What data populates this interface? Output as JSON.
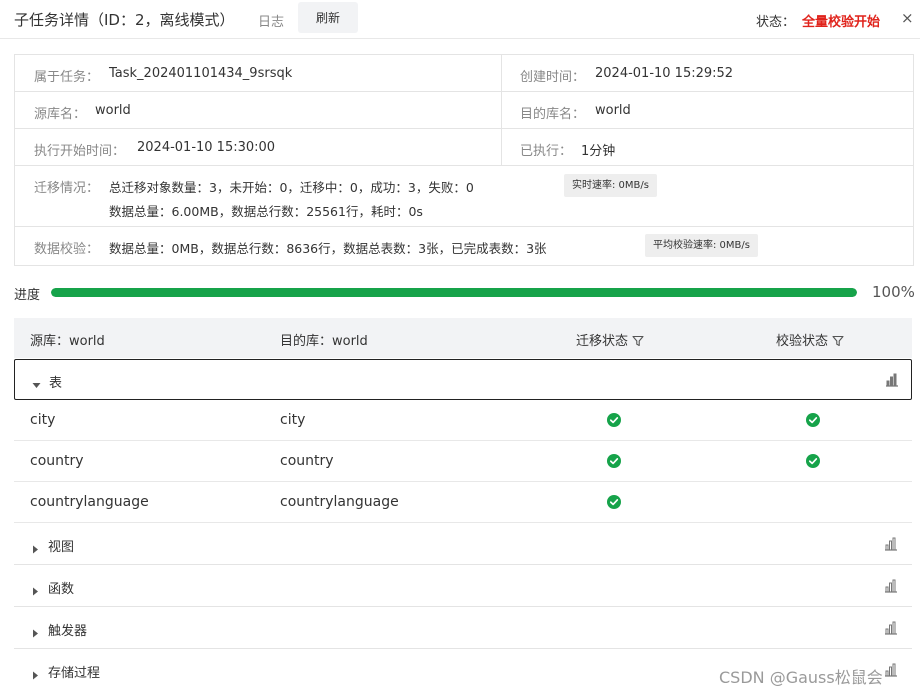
{
  "header": {
    "title": "子任务详情（ID：2，离线模式）",
    "log_link": "日志",
    "refresh_button": "刷新",
    "status_label": "状态：",
    "status_value": "全量校验开始",
    "close": "×"
  },
  "info": {
    "task_label": "属于任务：",
    "task_value": "Task_202401101434_9srsqk",
    "created_label": "创建时间：",
    "created_value": "2024-01-10 15:29:52",
    "source_label": "源库名：",
    "source_value": "world",
    "target_label": "目的库名：",
    "target_value": "world",
    "start_label": "执行开始时间：",
    "start_value": "2024-01-10 15:30:00",
    "elapsed_label": "已执行：",
    "elapsed_value": "1分钟",
    "migration_label": "迁移情况：",
    "migration_line1": "总迁移对象数量：3，未开始：0，迁移中：0，成功：3，失败：0",
    "migration_line2": "数据总量：6.00MB，数据总行数：25561行，耗时：0s",
    "realtime_speed": "实时速率: 0MB/s",
    "check_label": "数据校验：",
    "check_value": "数据总量：0MB，数据总行数：8636行，数据总表数：3张，已完成表数：3张",
    "avg_check_speed": "平均校验速率: 0MB/s"
  },
  "progress": {
    "label": "进度",
    "percent_text": "100%",
    "fraction": 1.0,
    "color": "#16a34a"
  },
  "table": {
    "headers": {
      "source": "源库：world",
      "target": "目的库：world",
      "migration_status": "迁移状态",
      "check_status": "校验状态"
    },
    "groups": {
      "tables": "表",
      "views": "视图",
      "functions": "函数",
      "triggers": "触发器",
      "procedures": "存储过程"
    },
    "rows": [
      {
        "source": "city",
        "target": "city",
        "migrated": true,
        "checked": true
      },
      {
        "source": "country",
        "target": "country",
        "migrated": true,
        "checked": true
      },
      {
        "source": "countrylanguage",
        "target": "countrylanguage",
        "migrated": true,
        "checked": false
      }
    ],
    "success_color": "#16a34a"
  },
  "watermark": "CSDN @Gauss松鼠会"
}
